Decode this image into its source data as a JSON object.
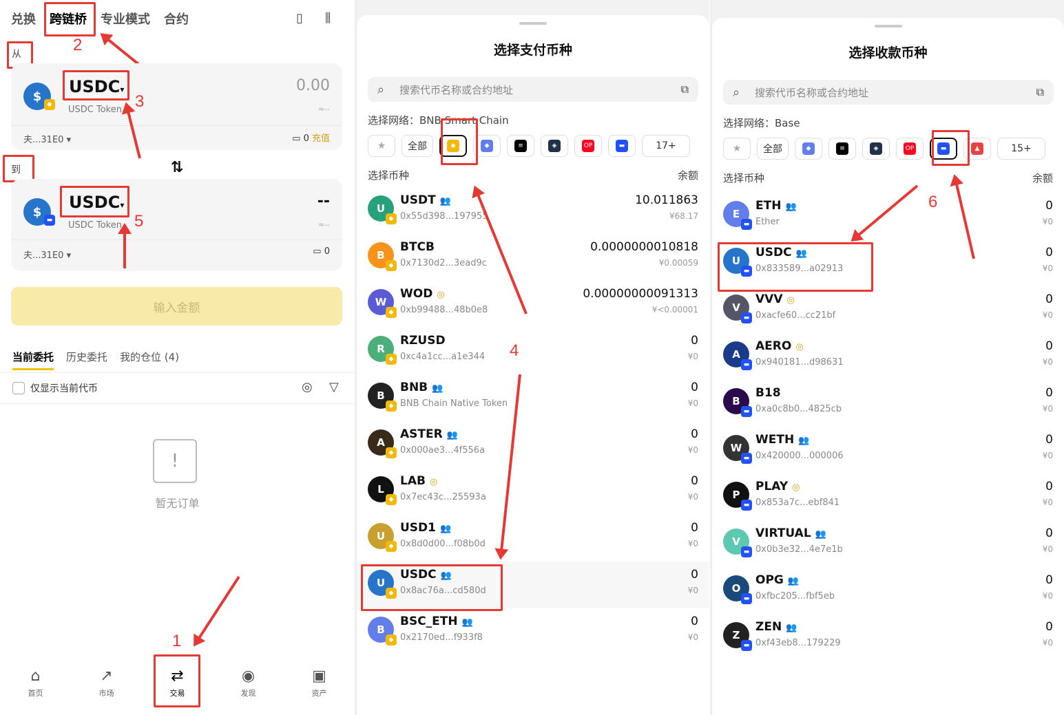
{
  "p1": {
    "nav": [
      "兑换",
      "跨链桥",
      "专业模式",
      "合约"
    ],
    "from_label": "从",
    "to_label": "到",
    "from": {
      "symbol": "USDC",
      "name": "USDC Token",
      "amount": "0.00",
      "approx": "≈--",
      "wallet": "夫...31E0",
      "balance": "0",
      "deposit": "充值"
    },
    "to": {
      "symbol": "USDC",
      "name": "USDC Token",
      "amount": "--",
      "approx": "≈--",
      "wallet": "夫...31E0",
      "balance": "0"
    },
    "swap_icon": "swap-vertical-icon",
    "action_button": "输入金额",
    "order_tabs": [
      "当前委托",
      "历史委托",
      "我的仓位 (4)"
    ],
    "only_current": "仅显示当前代币",
    "empty_text": "暂无订单",
    "bottom_tabs": [
      "首页",
      "市场",
      "交易",
      "发现",
      "资产"
    ],
    "annotations": [
      "1",
      "2",
      "3",
      "5"
    ]
  },
  "p2": {
    "title": "选择支付币种",
    "search_placeholder": "搜索代币名称或合约地址",
    "network_label": "选择网络：",
    "network_name": "BNB Smart Chain",
    "chip_all": "全部",
    "chip_more": "17+",
    "list_label": "选择币种",
    "balance_label": "余额",
    "annotation": "4",
    "tokens": [
      {
        "sym": "USDT",
        "addr": "0x55d398...197955",
        "bal": "10.011863",
        "fiat": "¥68.17",
        "color": "#26a17b",
        "tag": "group"
      },
      {
        "sym": "BTCB",
        "addr": "0x7130d2...3ead9c",
        "bal": "0.0000000010818",
        "fiat": "¥0.00059",
        "color": "#f7931a",
        "tag": ""
      },
      {
        "sym": "WOD",
        "addr": "0xb99488...48b0e8",
        "bal": "0.00000000091313",
        "fiat": "¥<0.00001",
        "color": "#5b5bd6",
        "tag": "gold"
      },
      {
        "sym": "RZUSD",
        "addr": "0xc4a1cc...a1e344",
        "bal": "0",
        "fiat": "¥0",
        "color": "#4caf7a",
        "tag": ""
      },
      {
        "sym": "BNB",
        "addr": "BNB Chain Native Token",
        "bal": "0",
        "fiat": "¥0",
        "color": "#222",
        "tag": "group"
      },
      {
        "sym": "ASTER",
        "addr": "0x000ae3...4f556a",
        "bal": "0",
        "fiat": "¥0",
        "color": "#3a2a1a",
        "tag": "group"
      },
      {
        "sym": "LAB",
        "addr": "0x7ec43c...25593a",
        "bal": "0",
        "fiat": "¥0",
        "color": "#111",
        "tag": "gold"
      },
      {
        "sym": "USD1",
        "addr": "0x8d0d00...f08b0d",
        "bal": "0",
        "fiat": "¥0",
        "color": "#c8a030",
        "tag": "group"
      },
      {
        "sym": "USDC",
        "addr": "0x8ac76a...cd580d",
        "bal": "0",
        "fiat": "¥0",
        "color": "#2775ca",
        "tag": "group"
      },
      {
        "sym": "BSC_ETH",
        "addr": "0x2170ed...f933f8",
        "bal": "0",
        "fiat": "¥0",
        "color": "#627eea",
        "tag": "group"
      }
    ]
  },
  "p3": {
    "title": "选择收款币种",
    "search_placeholder": "搜索代币名称或合约地址",
    "network_label": "选择网络：",
    "network_name": "Base",
    "chip_all": "全部",
    "chip_more": "15+",
    "list_label": "选择币种",
    "balance_label": "余额",
    "annotation": "6",
    "tokens": [
      {
        "sym": "ETH",
        "addr": "Ether",
        "bal": "0",
        "fiat": "¥0",
        "color": "#627eea",
        "tag": "group"
      },
      {
        "sym": "USDC",
        "addr": "0x833589...a02913",
        "bal": "0",
        "fiat": "¥0",
        "color": "#2775ca",
        "tag": "group"
      },
      {
        "sym": "VVV",
        "addr": "0xacfe60...cc21bf",
        "bal": "0",
        "fiat": "¥0",
        "color": "#556",
        "tag": "gold"
      },
      {
        "sym": "AERO",
        "addr": "0x940181...d98631",
        "bal": "0",
        "fiat": "¥0",
        "color": "#1a3a8a",
        "tag": "gold"
      },
      {
        "sym": "B18",
        "addr": "0xa0c8b0...4825cb",
        "bal": "0",
        "fiat": "¥0",
        "color": "#2a0a4a",
        "tag": ""
      },
      {
        "sym": "WETH",
        "addr": "0x420000...000006",
        "bal": "0",
        "fiat": "¥0",
        "color": "#333",
        "tag": "group"
      },
      {
        "sym": "PLAY",
        "addr": "0x853a7c...ebf841",
        "bal": "0",
        "fiat": "¥0",
        "color": "#111",
        "tag": "gold"
      },
      {
        "sym": "VIRTUAL",
        "addr": "0x0b3e32...4e7e1b",
        "bal": "0",
        "fiat": "¥0",
        "color": "#5cc8b0",
        "tag": "group"
      },
      {
        "sym": "OPG",
        "addr": "0xfbc205...fbf5eb",
        "bal": "0",
        "fiat": "¥0",
        "color": "#1a4a7a",
        "tag": "group"
      },
      {
        "sym": "ZEN",
        "addr": "0xf43eb8...179229",
        "bal": "0",
        "fiat": "¥0",
        "color": "#222",
        "tag": "group"
      }
    ]
  }
}
